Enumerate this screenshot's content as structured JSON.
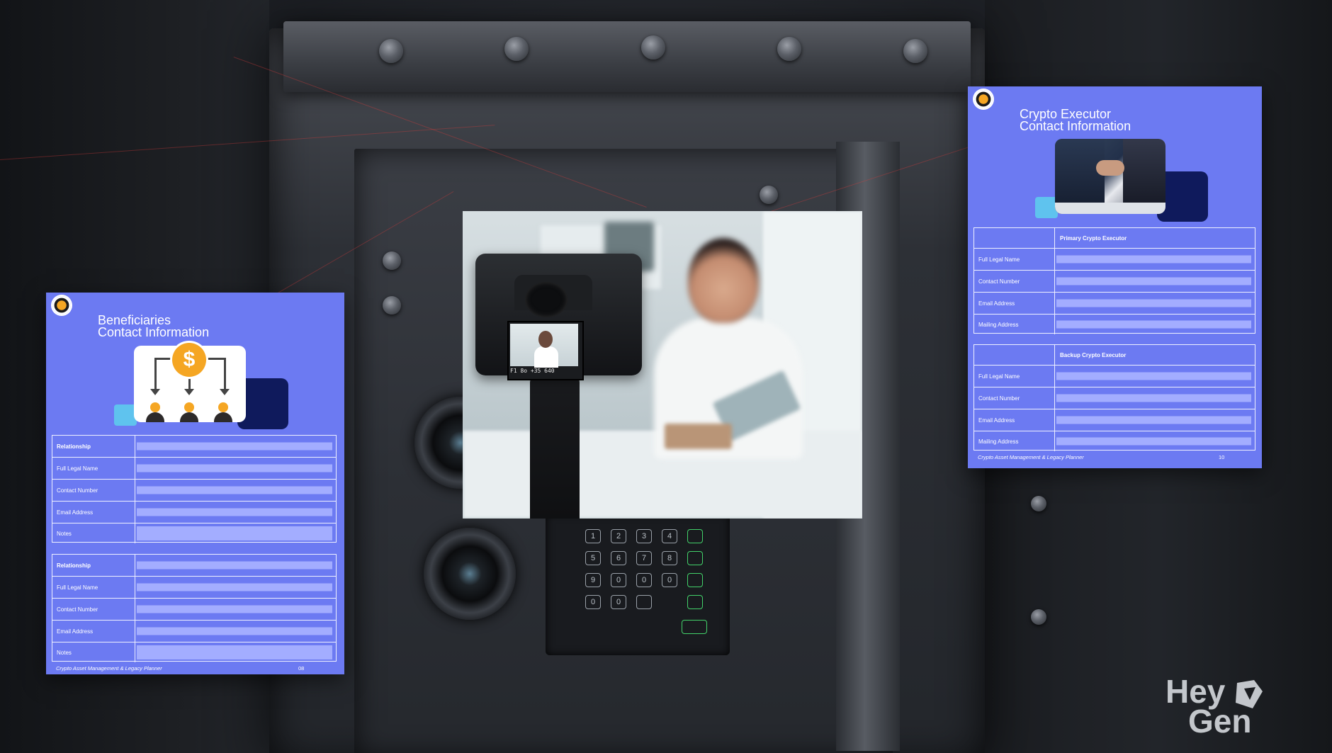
{
  "beneficiaries_card": {
    "title_line1": "Beneficiaries",
    "title_line2": "Contact Information",
    "coin_symbol": "$",
    "sections": [
      {
        "rows": [
          {
            "label": "Relationship",
            "bold": true
          },
          {
            "label": "Full Legal Name"
          },
          {
            "label": "Contact Number"
          },
          {
            "label": "Email Address"
          },
          {
            "label": "Notes"
          }
        ]
      },
      {
        "rows": [
          {
            "label": "Relationship",
            "bold": true
          },
          {
            "label": "Full Legal Name"
          },
          {
            "label": "Contact Number"
          },
          {
            "label": "Email Address"
          },
          {
            "label": "Notes"
          }
        ]
      }
    ],
    "footer": "Crypto Asset Management & Legacy Planner",
    "page_number": "08"
  },
  "executor_card": {
    "title_line1": "Crypto Executor",
    "title_line2": "Contact Information",
    "sections": [
      {
        "header": "Primary Crypto Executor",
        "rows": [
          {
            "label": "Full Legal Name"
          },
          {
            "label": "Contact Number"
          },
          {
            "label": "Email Address"
          },
          {
            "label": "Mailing Address"
          }
        ]
      },
      {
        "header": "Backup Crypto Executor",
        "rows": [
          {
            "label": "Full Legal Name"
          },
          {
            "label": "Contact Number"
          },
          {
            "label": "Email Address"
          },
          {
            "label": "Mailing Address"
          }
        ]
      }
    ],
    "footer": "Crypto Asset Management & Legacy Planner",
    "page_number": "10"
  },
  "camera": {
    "screen_readout": "F1  8o  +35  640"
  },
  "keypad": {
    "keys": [
      "1",
      "2",
      "3",
      "4",
      "5",
      "6",
      "7",
      "8",
      "9",
      "0",
      "0",
      "0",
      "0",
      "0"
    ]
  },
  "watermark": {
    "line1": "Hey",
    "line2": "Gen"
  },
  "colors": {
    "card_bg": "#6c7af2",
    "field_fill": "#a3adff",
    "accent_dark": "#0f1a5c",
    "accent_light": "#5fc3ee",
    "coin": "#f5a623"
  }
}
